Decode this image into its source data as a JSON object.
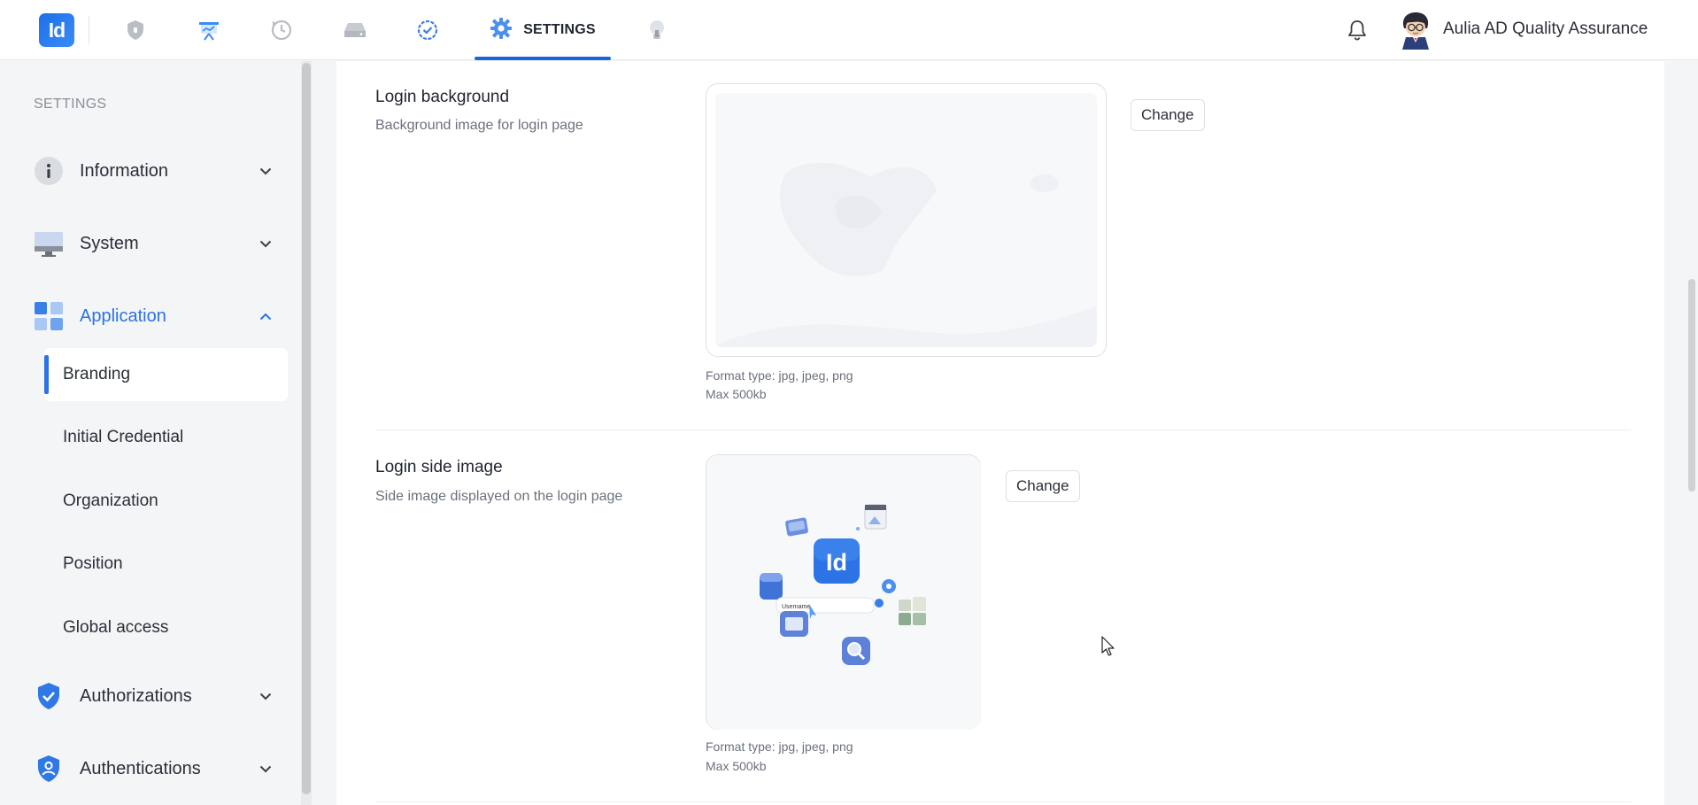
{
  "topbar": {
    "logo_text": "Id",
    "active_tab_label": "SETTINGS",
    "user_name": "Aulia AD Quality Assurance",
    "nav_icons": [
      "shield-icon",
      "presentation-icon",
      "history-icon",
      "drive-icon",
      "check-badge-icon",
      "gear-icon",
      "lightbulb-icon"
    ]
  },
  "sidebar": {
    "heading": "SETTINGS",
    "groups": [
      {
        "label": "Information",
        "icon": "info-icon",
        "expanded": false
      },
      {
        "label": "System",
        "icon": "monitor-icon",
        "expanded": false
      },
      {
        "label": "Application",
        "icon": "grid-icon",
        "expanded": true
      },
      {
        "label": "Authorizations",
        "icon": "shield-check-icon",
        "expanded": false
      },
      {
        "label": "Authentications",
        "icon": "shield-user-icon",
        "expanded": false
      }
    ],
    "sub_items": [
      {
        "label": "Branding",
        "active": true
      },
      {
        "label": "Initial Credential",
        "active": false
      },
      {
        "label": "Organization",
        "active": false
      },
      {
        "label": "Position",
        "active": false
      },
      {
        "label": "Global access",
        "active": false
      }
    ]
  },
  "main": {
    "rows": [
      {
        "title": "Login background",
        "description": "Background image for login page",
        "change_label": "Change",
        "format_hint": "Format type: jpg, jpeg, png",
        "size_hint": "Max 500kb"
      },
      {
        "title": "Login side image",
        "description": "Side image displayed on the login page",
        "change_label": "Change",
        "format_hint": "Format type: jpg, jpeg, png",
        "size_hint": "Max 500kb",
        "illustration_logo": "Id",
        "illustration_input": "Username"
      }
    ]
  },
  "colors": {
    "accent": "#2a72e6",
    "tab_underline": "#1b66e0"
  }
}
